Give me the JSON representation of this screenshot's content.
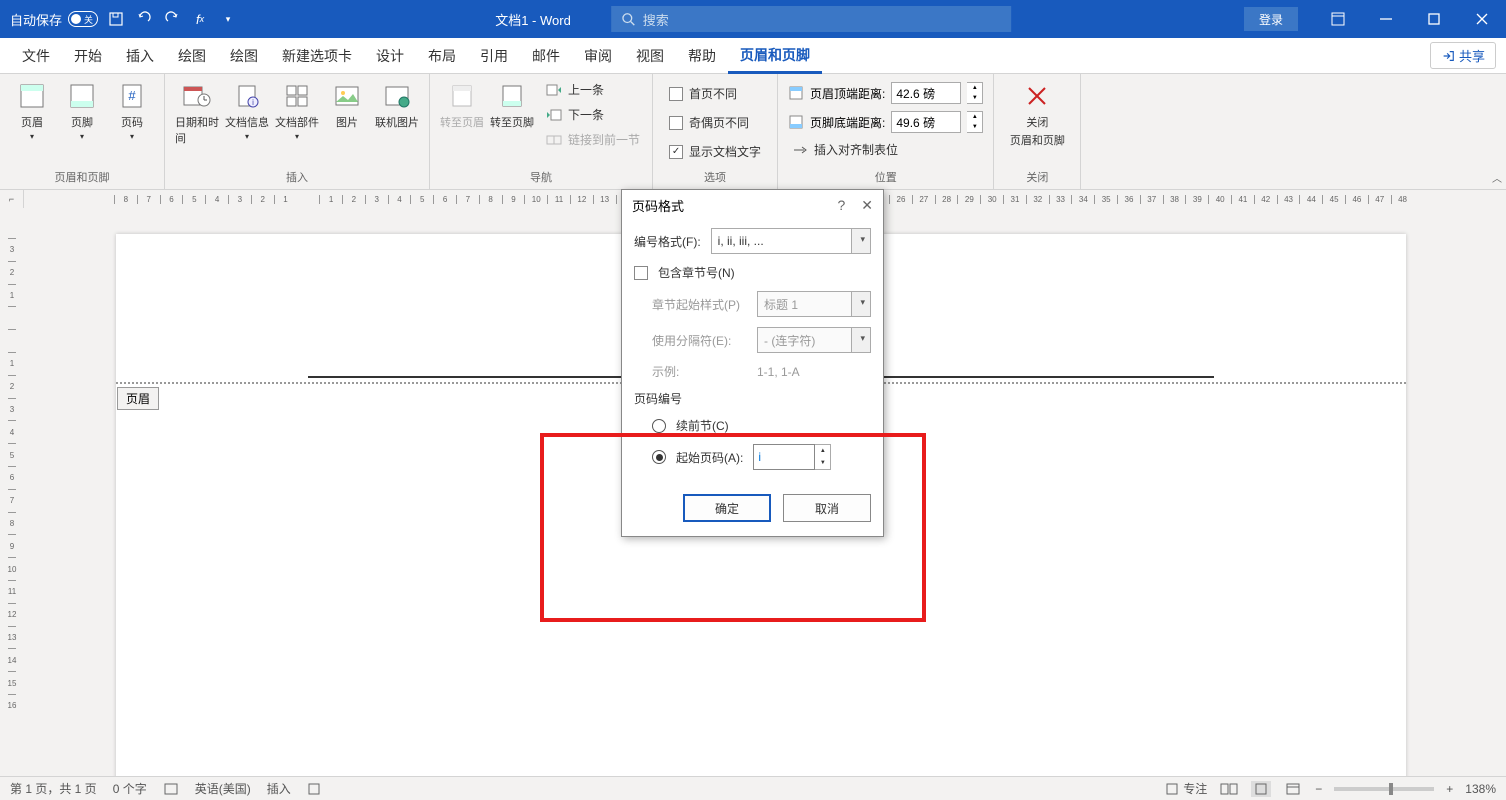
{
  "titlebar": {
    "autosave": "自动保存",
    "autosave_state": "关",
    "doc_title": "文档1 - Word",
    "search_placeholder": "搜索",
    "login": "登录"
  },
  "tabs": {
    "file": "文件",
    "home": "开始",
    "insert": "插入",
    "draw": "绘图",
    "draw2": "绘图",
    "newtab": "新建选项卡",
    "design": "设计",
    "layout": "布局",
    "reference": "引用",
    "mail": "邮件",
    "review": "审阅",
    "view": "视图",
    "help": "帮助",
    "header_footer": "页眉和页脚",
    "share": "共享"
  },
  "ribbon": {
    "header": "页眉",
    "footer": "页脚",
    "page_num": "页码",
    "datetime": "日期和时间",
    "doc_info": "文档信息",
    "doc_parts": "文档部件",
    "picture": "图片",
    "online_pic": "联机图片",
    "goto_header": "转至页眉",
    "goto_footer": "转至页脚",
    "prev": "上一条",
    "next": "下一条",
    "link_prev": "链接到前一节",
    "first_diff": "首页不同",
    "odd_even_diff": "奇偶页不同",
    "show_doc": "显示文档文字",
    "header_top": "页眉顶端距离:",
    "header_top_val": "42.6 磅",
    "footer_bottom": "页脚底端距离:",
    "footer_bottom_val": "49.6 磅",
    "insert_align": "插入对齐制表位",
    "close": "关闭",
    "close_hf": "页眉和页脚",
    "g1": "页眉和页脚",
    "g2": "插入",
    "g3": "导航",
    "g4": "选项",
    "g5": "位置",
    "g6": "关闭"
  },
  "doc": {
    "header_tag": "页眉"
  },
  "dialog": {
    "title": "页码格式",
    "num_format_label": "编号格式(F):",
    "num_format_val": "i, ii, iii, ...",
    "include_chapter": "包含章节号(N)",
    "chapter_style_label": "章节起始样式(P)",
    "chapter_style_val": "标题 1",
    "separator_label": "使用分隔符(E):",
    "separator_val": "- (连字符)",
    "example_label": "示例:",
    "example_val": "1-1, 1-A",
    "section_title": "页码编号",
    "continue": "续前节(C)",
    "start_at": "起始页码(A):",
    "start_at_val": "i",
    "ok": "确定",
    "cancel": "取消"
  },
  "statusbar": {
    "page": "第 1 页，共 1 页",
    "words": "0 个字",
    "lang": "英语(美国)",
    "insert": "插入",
    "focus": "专注",
    "zoom": "138%"
  }
}
